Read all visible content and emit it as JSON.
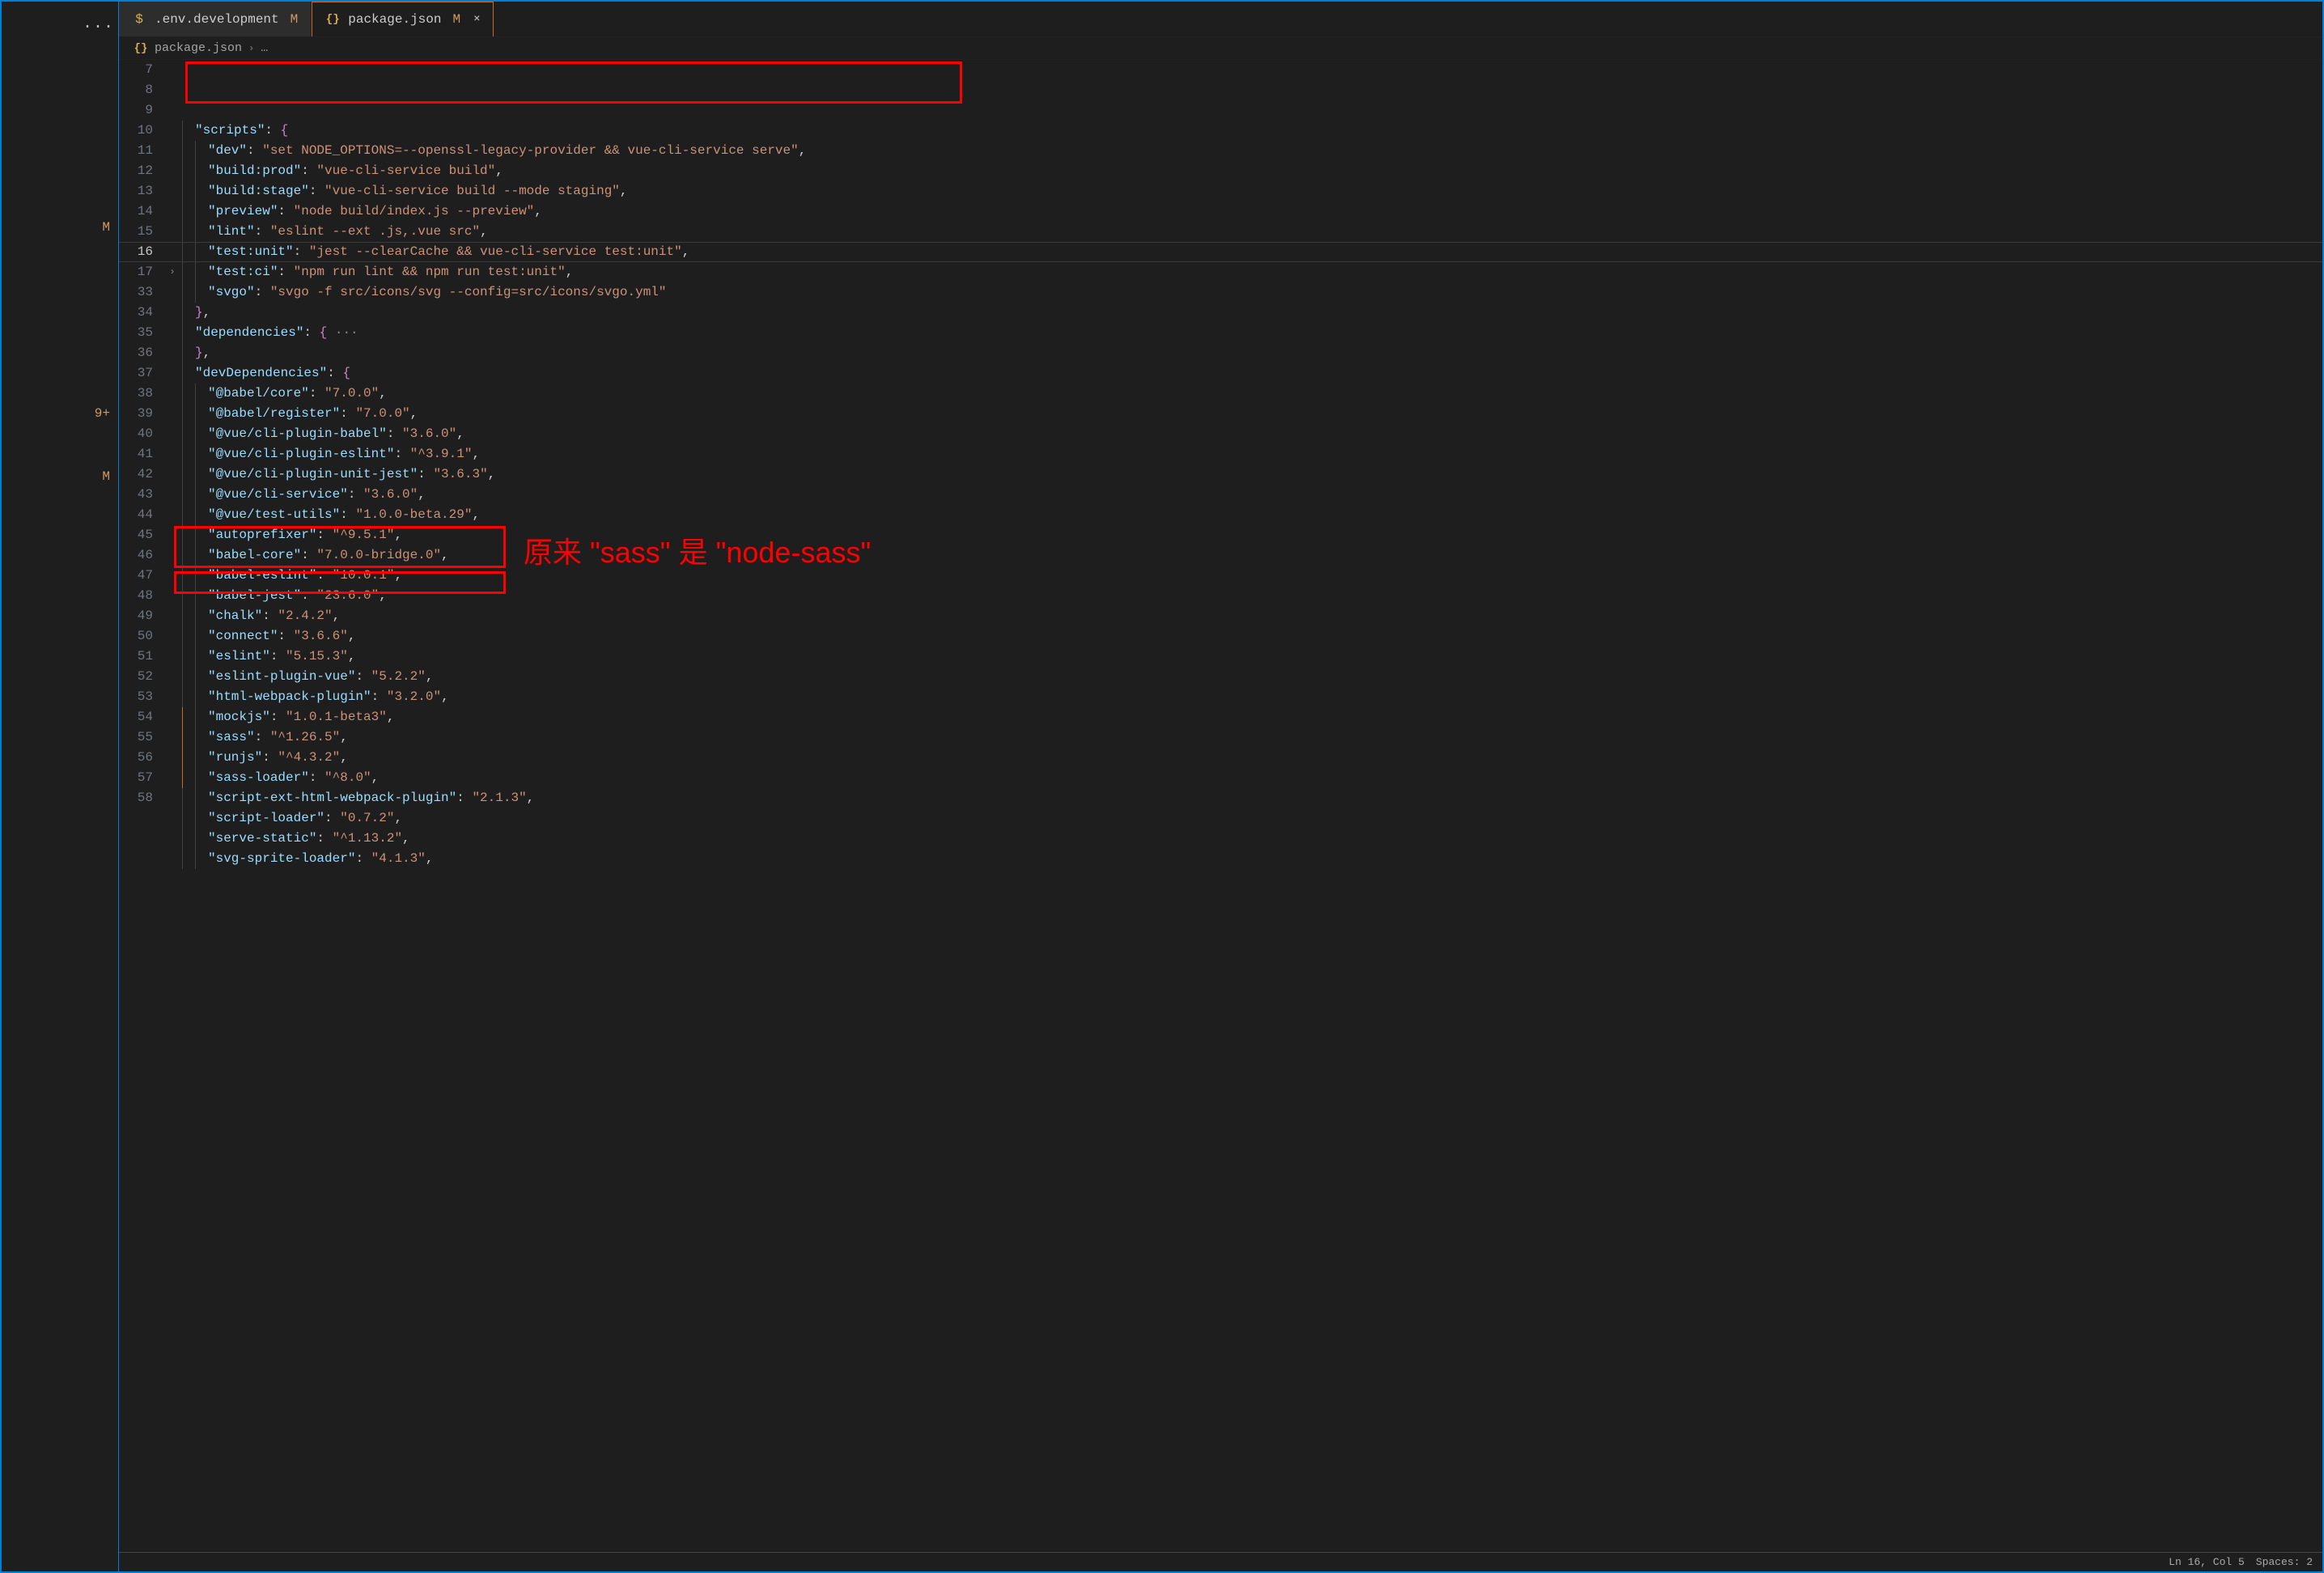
{
  "tabs": [
    {
      "icon": "$",
      "label": ".env.development",
      "modified": "M"
    },
    {
      "icon": "{}",
      "label": "package.json",
      "modified": "M",
      "close": "×"
    }
  ],
  "breadcrumb": {
    "icon": "{}",
    "file": "package.json",
    "sep": "›",
    "more": "…"
  },
  "sidebar": {
    "ellipsis": "···",
    "badges": {
      "m1": "M",
      "count": "9+",
      "m2": "M"
    }
  },
  "lineNumbers": [
    "7",
    "8",
    "9",
    "10",
    "11",
    "12",
    "13",
    "14",
    "15",
    "16",
    "17",
    "33",
    "34",
    "35",
    "36",
    "37",
    "38",
    "39",
    "40",
    "41",
    "42",
    "43",
    "44",
    "45",
    "46",
    "47",
    "48",
    "49",
    "50",
    "51",
    "52",
    "53",
    "54",
    "55",
    "56",
    "57",
    "58"
  ],
  "activeLine": "16",
  "foldableAt": "17",
  "code": {
    "l7": {
      "indent": 1,
      "k": "scripts",
      "after": ": {"
    },
    "l8": {
      "indent": 2,
      "k": "dev",
      "v": "set NODE_OPTIONS=--openssl-legacy-provider && vue-cli-service serve"
    },
    "l9": {
      "indent": 2,
      "k": "build:prod",
      "v": "vue-cli-service build"
    },
    "l10": {
      "indent": 2,
      "k": "build:stage",
      "v": "vue-cli-service build --mode staging"
    },
    "l11": {
      "indent": 2,
      "k": "preview",
      "v": "node build/index.js --preview"
    },
    "l12": {
      "indent": 2,
      "k": "lint",
      "v": "eslint --ext .js,.vue src"
    },
    "l13": {
      "indent": 2,
      "k": "test:unit",
      "v": "jest --clearCache && vue-cli-service test:unit"
    },
    "l14": {
      "indent": 2,
      "k": "test:ci",
      "v": "npm run lint && npm run test:unit"
    },
    "l15": {
      "indent": 2,
      "k": "svgo",
      "v": "svgo -f src/icons/svg --config=src/icons/svgo.yml",
      "last": true
    },
    "l16": {
      "indent": 1,
      "close": "},"
    },
    "l17": {
      "indent": 1,
      "k": "dependencies",
      "after": ": {",
      "folded": true
    },
    "l33": {
      "indent": 1,
      "close": "},"
    },
    "l34": {
      "indent": 1,
      "k": "devDependencies",
      "after": ": {"
    },
    "l35": {
      "indent": 2,
      "k": "@babel/core",
      "v": "7.0.0"
    },
    "l36": {
      "indent": 2,
      "k": "@babel/register",
      "v": "7.0.0"
    },
    "l37": {
      "indent": 2,
      "k": "@vue/cli-plugin-babel",
      "v": "3.6.0"
    },
    "l38": {
      "indent": 2,
      "k": "@vue/cli-plugin-eslint",
      "v": "^3.9.1"
    },
    "l39": {
      "indent": 2,
      "k": "@vue/cli-plugin-unit-jest",
      "v": "3.6.3"
    },
    "l40": {
      "indent": 2,
      "k": "@vue/cli-service",
      "v": "3.6.0"
    },
    "l41": {
      "indent": 2,
      "k": "@vue/test-utils",
      "v": "1.0.0-beta.29"
    },
    "l42": {
      "indent": 2,
      "k": "autoprefixer",
      "v": "^9.5.1"
    },
    "l43": {
      "indent": 2,
      "k": "babel-core",
      "v": "7.0.0-bridge.0"
    },
    "l44": {
      "indent": 2,
      "k": "babel-eslint",
      "v": "10.0.1"
    },
    "l45": {
      "indent": 2,
      "k": "babel-jest",
      "v": "23.6.0"
    },
    "l46": {
      "indent": 2,
      "k": "chalk",
      "v": "2.4.2"
    },
    "l47": {
      "indent": 2,
      "k": "connect",
      "v": "3.6.6"
    },
    "l48": {
      "indent": 2,
      "k": "eslint",
      "v": "5.15.3"
    },
    "l49": {
      "indent": 2,
      "k": "eslint-plugin-vue",
      "v": "5.2.2"
    },
    "l50": {
      "indent": 2,
      "k": "html-webpack-plugin",
      "v": "3.2.0"
    },
    "l51": {
      "indent": 2,
      "k": "mockjs",
      "v": "1.0.1-beta3"
    },
    "l52": {
      "indent": 2,
      "k": "sass",
      "v": "^1.26.5"
    },
    "l53": {
      "indent": 2,
      "k": "runjs",
      "v": "^4.3.2"
    },
    "l54": {
      "indent": 2,
      "k": "sass-loader",
      "v": "^8.0"
    },
    "l55": {
      "indent": 2,
      "k": "script-ext-html-webpack-plugin",
      "v": "2.1.3"
    },
    "l56": {
      "indent": 2,
      "k": "script-loader",
      "v": "0.7.2"
    },
    "l57": {
      "indent": 2,
      "k": "serve-static",
      "v": "^1.13.2"
    },
    "l58": {
      "indent": 2,
      "k": "svg-sprite-loader",
      "v": "4.1.3"
    }
  },
  "annotation": {
    "text": "原来 \"sass\" 是 \"node-sass\""
  },
  "statusbar": {
    "pos": "Ln 16, Col 5",
    "spaces": "Spaces: 2"
  }
}
